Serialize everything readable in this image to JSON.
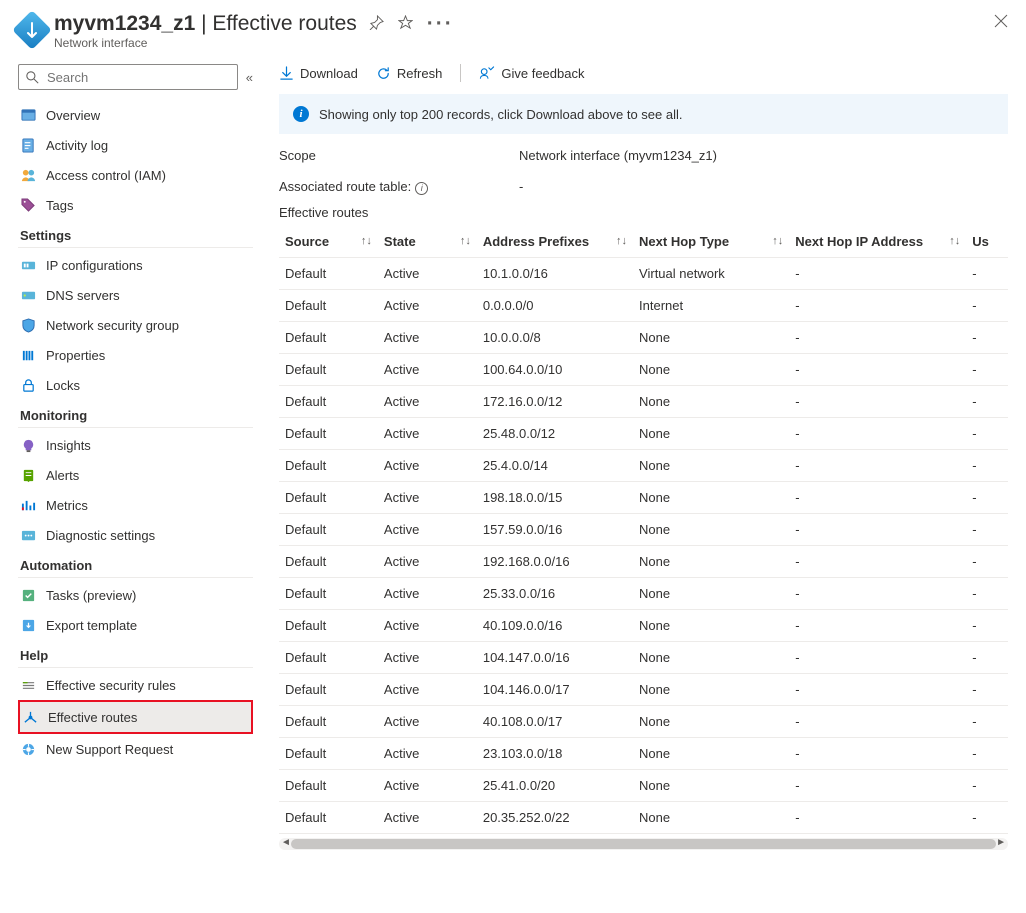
{
  "header": {
    "resource_name": "myvm1234_z1",
    "page_name": "Effective routes",
    "subtitle": "Network interface"
  },
  "sidebar": {
    "search_placeholder": "Search",
    "top": [
      {
        "label": "Overview",
        "icon": "overview"
      },
      {
        "label": "Activity log",
        "icon": "activitylog"
      },
      {
        "label": "Access control (IAM)",
        "icon": "iam"
      },
      {
        "label": "Tags",
        "icon": "tags"
      }
    ],
    "sections": [
      {
        "title": "Settings",
        "items": [
          {
            "label": "IP configurations",
            "icon": "ipconfig"
          },
          {
            "label": "DNS servers",
            "icon": "dns"
          },
          {
            "label": "Network security group",
            "icon": "nsg"
          },
          {
            "label": "Properties",
            "icon": "properties"
          },
          {
            "label": "Locks",
            "icon": "locks"
          }
        ]
      },
      {
        "title": "Monitoring",
        "items": [
          {
            "label": "Insights",
            "icon": "insights"
          },
          {
            "label": "Alerts",
            "icon": "alerts"
          },
          {
            "label": "Metrics",
            "icon": "metrics"
          },
          {
            "label": "Diagnostic settings",
            "icon": "diag"
          }
        ]
      },
      {
        "title": "Automation",
        "items": [
          {
            "label": "Tasks (preview)",
            "icon": "tasks"
          },
          {
            "label": "Export template",
            "icon": "export"
          }
        ]
      },
      {
        "title": "Help",
        "items": [
          {
            "label": "Effective security rules",
            "icon": "secrules"
          },
          {
            "label": "Effective routes",
            "icon": "routes",
            "highlight": true
          },
          {
            "label": "New Support Request",
            "icon": "support"
          }
        ]
      }
    ]
  },
  "toolbar": {
    "download": "Download",
    "refresh": "Refresh",
    "feedback": "Give feedback"
  },
  "info": {
    "message": "Showing only top 200 records, click Download above to see all."
  },
  "scope": {
    "label": "Scope",
    "value": "Network interface (myvm1234_z1)"
  },
  "assoc": {
    "label": "Associated route table:",
    "value": "-"
  },
  "table": {
    "title": "Effective routes",
    "columns": {
      "source": "Source",
      "state": "State",
      "prefix": "Address Prefixes",
      "hoptype": "Next Hop Type",
      "hopip": "Next Hop IP Address",
      "us": "Us"
    },
    "rows": [
      {
        "source": "Default",
        "state": "Active",
        "prefix": "10.1.0.0/16",
        "hoptype": "Virtual network",
        "hopip": "-",
        "us": "-"
      },
      {
        "source": "Default",
        "state": "Active",
        "prefix": "0.0.0.0/0",
        "hoptype": "Internet",
        "hopip": "-",
        "us": "-"
      },
      {
        "source": "Default",
        "state": "Active",
        "prefix": "10.0.0.0/8",
        "hoptype": "None",
        "hopip": "-",
        "us": "-"
      },
      {
        "source": "Default",
        "state": "Active",
        "prefix": "100.64.0.0/10",
        "hoptype": "None",
        "hopip": "-",
        "us": "-"
      },
      {
        "source": "Default",
        "state": "Active",
        "prefix": "172.16.0.0/12",
        "hoptype": "None",
        "hopip": "-",
        "us": "-"
      },
      {
        "source": "Default",
        "state": "Active",
        "prefix": "25.48.0.0/12",
        "hoptype": "None",
        "hopip": "-",
        "us": "-"
      },
      {
        "source": "Default",
        "state": "Active",
        "prefix": "25.4.0.0/14",
        "hoptype": "None",
        "hopip": "-",
        "us": "-"
      },
      {
        "source": "Default",
        "state": "Active",
        "prefix": "198.18.0.0/15",
        "hoptype": "None",
        "hopip": "-",
        "us": "-"
      },
      {
        "source": "Default",
        "state": "Active",
        "prefix": "157.59.0.0/16",
        "hoptype": "None",
        "hopip": "-",
        "us": "-"
      },
      {
        "source": "Default",
        "state": "Active",
        "prefix": "192.168.0.0/16",
        "hoptype": "None",
        "hopip": "-",
        "us": "-"
      },
      {
        "source": "Default",
        "state": "Active",
        "prefix": "25.33.0.0/16",
        "hoptype": "None",
        "hopip": "-",
        "us": "-"
      },
      {
        "source": "Default",
        "state": "Active",
        "prefix": "40.109.0.0/16",
        "hoptype": "None",
        "hopip": "-",
        "us": "-"
      },
      {
        "source": "Default",
        "state": "Active",
        "prefix": "104.147.0.0/16",
        "hoptype": "None",
        "hopip": "-",
        "us": "-"
      },
      {
        "source": "Default",
        "state": "Active",
        "prefix": "104.146.0.0/17",
        "hoptype": "None",
        "hopip": "-",
        "us": "-"
      },
      {
        "source": "Default",
        "state": "Active",
        "prefix": "40.108.0.0/17",
        "hoptype": "None",
        "hopip": "-",
        "us": "-"
      },
      {
        "source": "Default",
        "state": "Active",
        "prefix": "23.103.0.0/18",
        "hoptype": "None",
        "hopip": "-",
        "us": "-"
      },
      {
        "source": "Default",
        "state": "Active",
        "prefix": "25.41.0.0/20",
        "hoptype": "None",
        "hopip": "-",
        "us": "-"
      },
      {
        "source": "Default",
        "state": "Active",
        "prefix": "20.35.252.0/22",
        "hoptype": "None",
        "hopip": "-",
        "us": "-"
      }
    ]
  }
}
